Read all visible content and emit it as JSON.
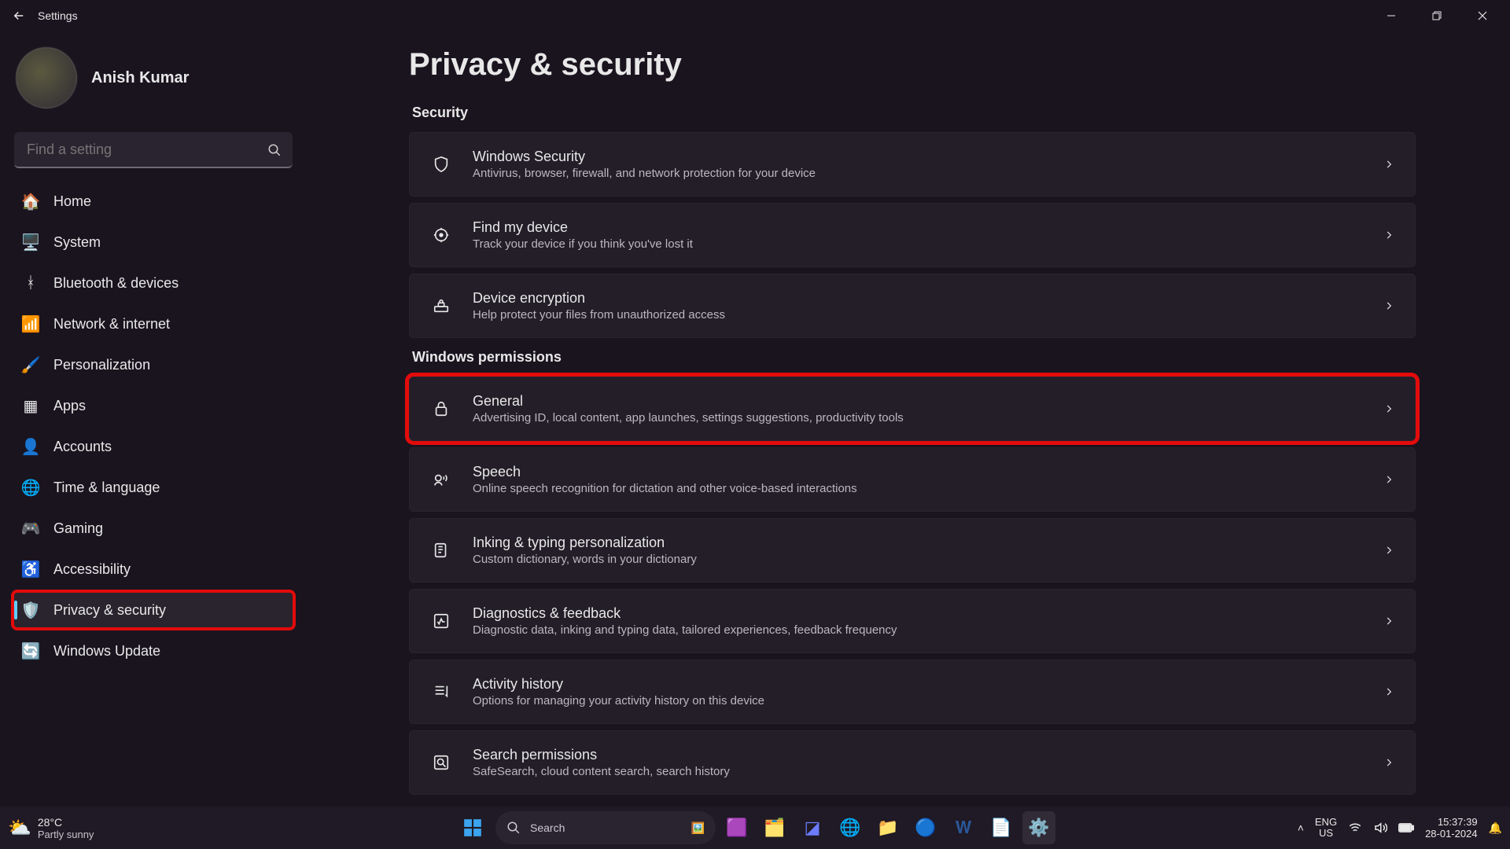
{
  "window": {
    "title": "Settings"
  },
  "profile": {
    "name": "Anish Kumar"
  },
  "search": {
    "placeholder": "Find a setting"
  },
  "nav": [
    {
      "key": "home",
      "label": "Home",
      "icon": "🏠"
    },
    {
      "key": "system",
      "label": "System",
      "icon": "🖥️"
    },
    {
      "key": "bluetooth",
      "label": "Bluetooth & devices",
      "icon": "ᚼ"
    },
    {
      "key": "network",
      "label": "Network & internet",
      "icon": "📶"
    },
    {
      "key": "personalization",
      "label": "Personalization",
      "icon": "🖌️"
    },
    {
      "key": "apps",
      "label": "Apps",
      "icon": "▦"
    },
    {
      "key": "accounts",
      "label": "Accounts",
      "icon": "👤"
    },
    {
      "key": "time",
      "label": "Time & language",
      "icon": "🌐"
    },
    {
      "key": "gaming",
      "label": "Gaming",
      "icon": "🎮"
    },
    {
      "key": "accessibility",
      "label": "Accessibility",
      "icon": "♿"
    },
    {
      "key": "privacy",
      "label": "Privacy & security",
      "icon": "🛡️",
      "active": true,
      "highlight": true
    },
    {
      "key": "update",
      "label": "Windows Update",
      "icon": "🔄"
    }
  ],
  "page": {
    "title": "Privacy & security",
    "sections": [
      {
        "header": "Security",
        "items": [
          {
            "key": "winsec",
            "icon": "shield",
            "title": "Windows Security",
            "sub": "Antivirus, browser, firewall, and network protection for your device"
          },
          {
            "key": "findmy",
            "icon": "locate",
            "title": "Find my device",
            "sub": "Track your device if you think you've lost it"
          },
          {
            "key": "encr",
            "icon": "lockdrive",
            "title": "Device encryption",
            "sub": "Help protect your files from unauthorized access"
          }
        ]
      },
      {
        "header": "Windows permissions",
        "items": [
          {
            "key": "general",
            "icon": "lock",
            "title": "General",
            "sub": "Advertising ID, local content, app launches, settings suggestions, productivity tools",
            "highlight": true
          },
          {
            "key": "speech",
            "icon": "speech",
            "title": "Speech",
            "sub": "Online speech recognition for dictation and other voice-based interactions"
          },
          {
            "key": "inking",
            "icon": "inking",
            "title": "Inking & typing personalization",
            "sub": "Custom dictionary, words in your dictionary"
          },
          {
            "key": "diag",
            "icon": "diag",
            "title": "Diagnostics & feedback",
            "sub": "Diagnostic data, inking and typing data, tailored experiences, feedback frequency"
          },
          {
            "key": "activity",
            "icon": "activity",
            "title": "Activity history",
            "sub": "Options for managing your activity history on this device"
          },
          {
            "key": "searchperm",
            "icon": "searchperm",
            "title": "Search permissions",
            "sub": "SafeSearch, cloud content search, search history"
          }
        ]
      }
    ]
  },
  "taskbar": {
    "weather": {
      "temp": "28°C",
      "desc": "Partly sunny"
    },
    "search": "Search",
    "lang1": "ENG",
    "lang2": "US",
    "time": "15:37:39",
    "date": "28-01-2024"
  }
}
